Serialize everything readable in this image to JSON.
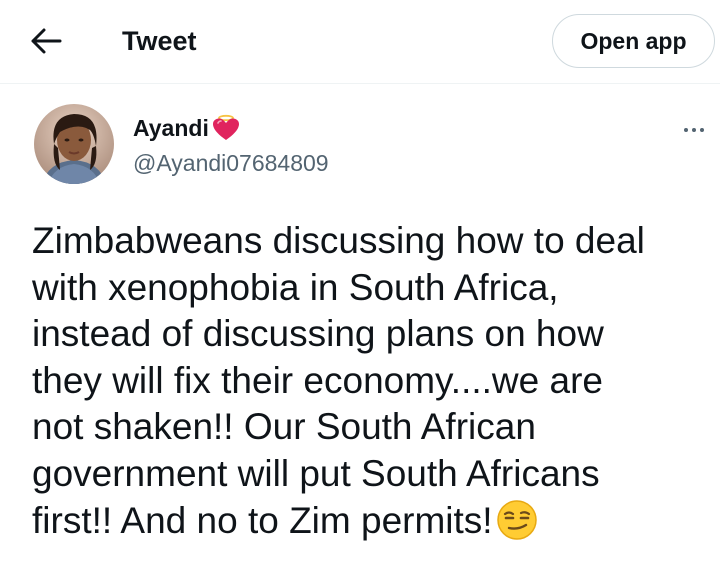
{
  "header": {
    "title": "Tweet",
    "open_app_label": "Open app",
    "back_icon": "arrow-left-icon"
  },
  "author": {
    "display_name": "Ayandi",
    "name_emoji": "heart-with-halo-icon",
    "handle": "@Ayandi07684809",
    "avatar": "profile-photo"
  },
  "tweet": {
    "lines": [
      "Zimbabweans discussing how to deal",
      "with xenophobia in South Africa,",
      "instead of discussing plans on how",
      "they will fix their economy....we are",
      "not shaken!! Our South African",
      "government will put South Africans",
      "first!! And no to Zim permits!"
    ],
    "trailing_emoji": "smirking-face-icon"
  },
  "colors": {
    "text": "#0f1419",
    "secondary": "#536471",
    "border": "#cfd9de",
    "heart": "#e0245e"
  }
}
